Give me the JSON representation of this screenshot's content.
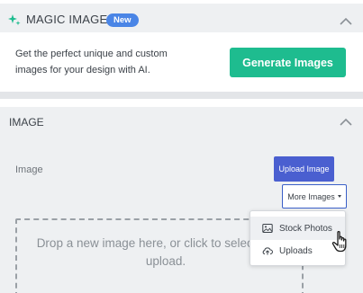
{
  "magic_image": {
    "title": "MAGIC IMAGE",
    "badge": "New",
    "description": "Get the perfect unique and custom images for your design with AI.",
    "generate_label": "Generate Images"
  },
  "image_section": {
    "title": "IMAGE",
    "field_label": "Image",
    "upload_label": "Upload Image",
    "more_images_label": "More Images",
    "dropzone_text": "Drop a new image here, or click to select files to upload.",
    "menu": [
      {
        "label": "Stock Photos",
        "icon": "image-icon"
      },
      {
        "label": "Uploads",
        "icon": "cloud-upload-icon"
      }
    ]
  },
  "colors": {
    "accent_green": "#1ebc8f",
    "accent_blue": "#4a5fd0",
    "badge_blue": "#4a85e6",
    "panel_bg": "#eef0f2"
  }
}
